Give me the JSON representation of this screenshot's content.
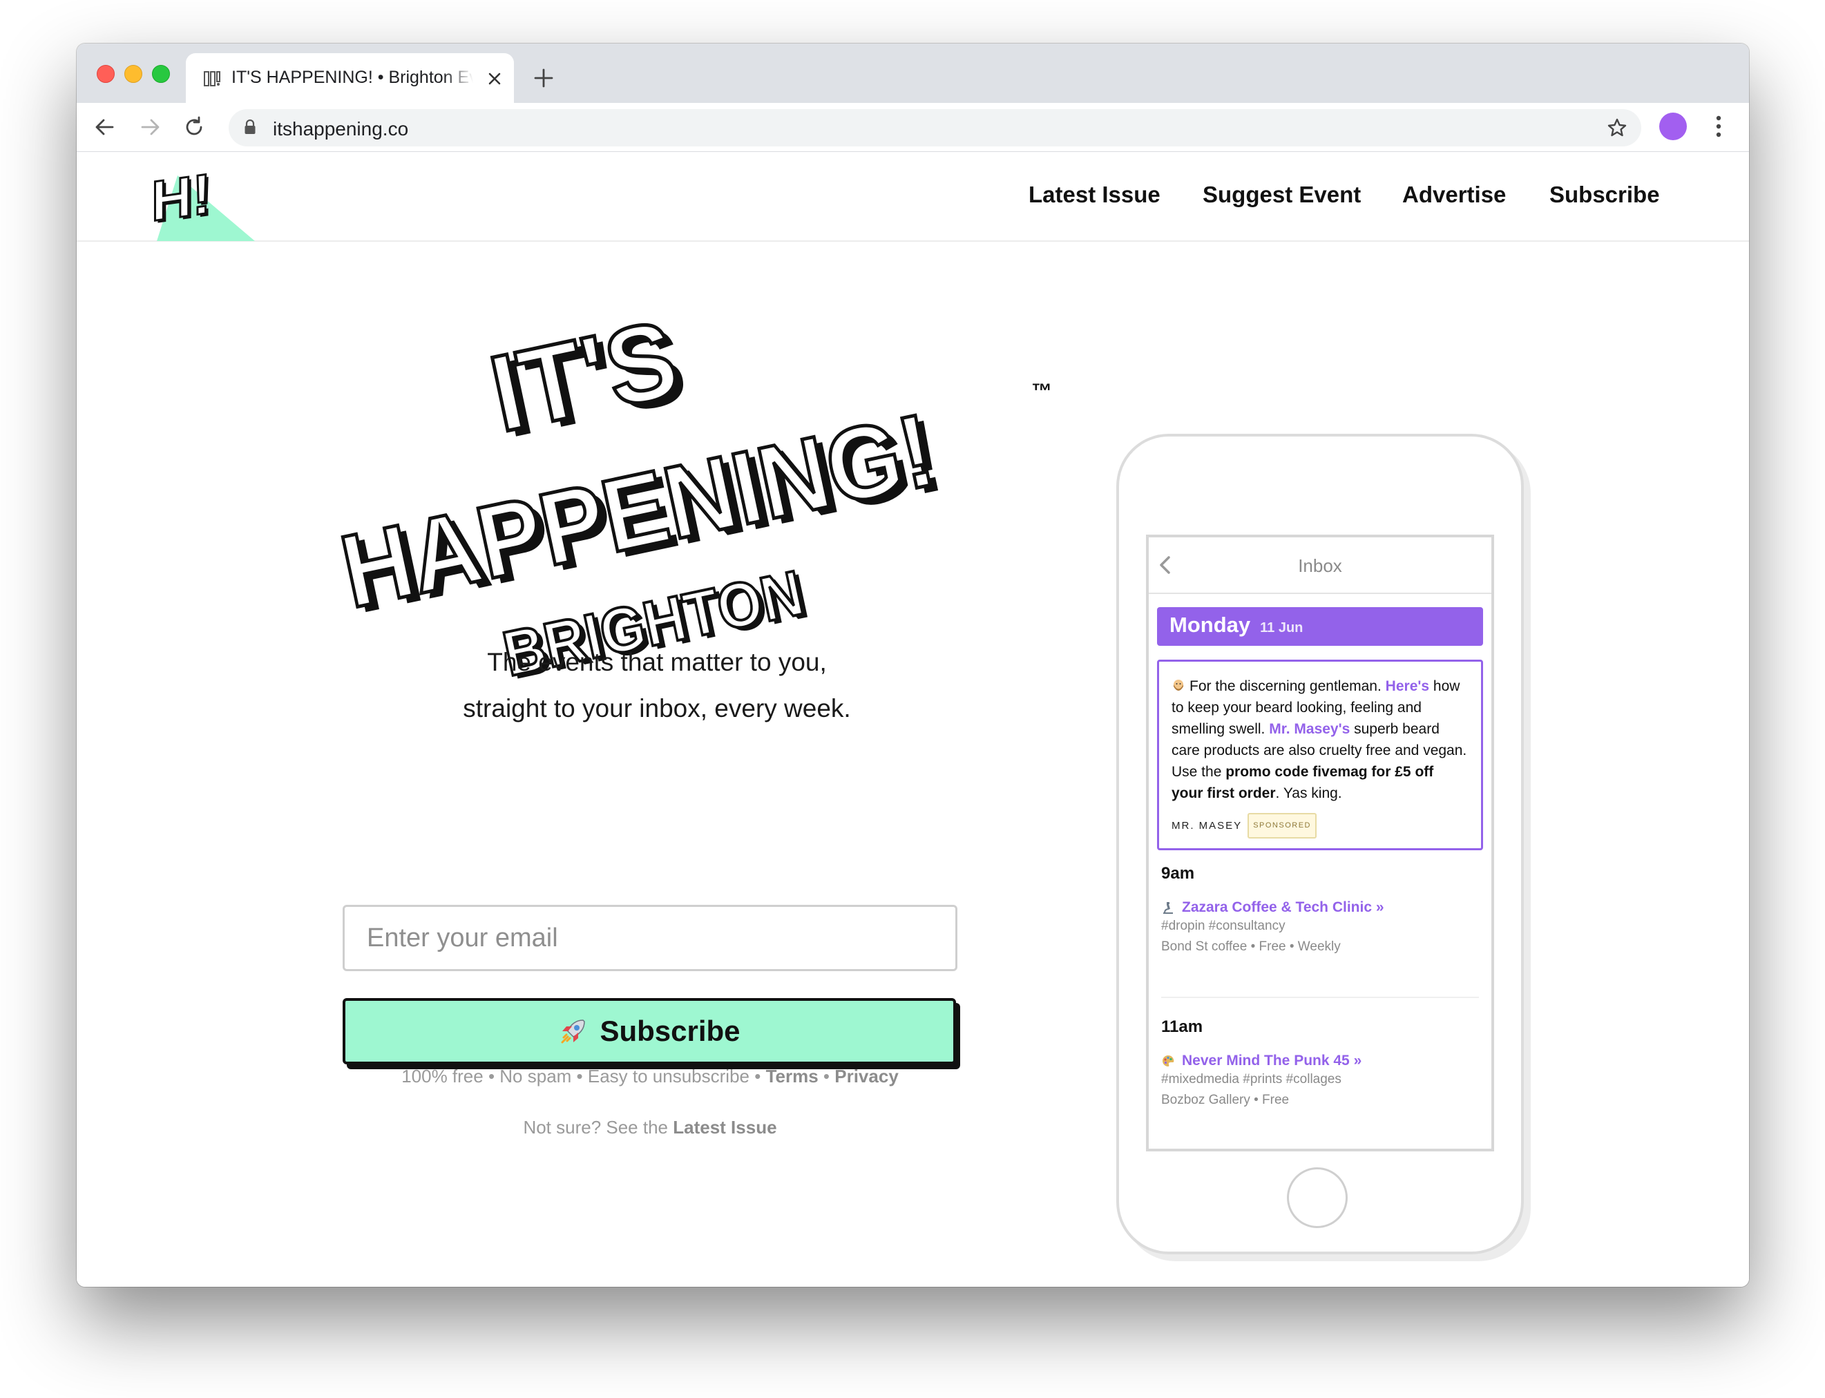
{
  "browser": {
    "tab_title": "IT'S HAPPENING! • Brighton Events",
    "url": "itshappening.co",
    "accent_avatar": "#a25ff0"
  },
  "site": {
    "nav": [
      {
        "label": "Latest Issue"
      },
      {
        "label": "Suggest Event"
      },
      {
        "label": "Advertise"
      },
      {
        "label": "Subscribe"
      }
    ],
    "hero": {
      "line1": "IT'S",
      "line2": "HAPPENING!",
      "tm": "™",
      "city": "BRIGHTON"
    },
    "tagline_1": "The events that matter to you,",
    "tagline_2": "straight to your inbox, every week.",
    "email_placeholder": "Enter your email",
    "subscribe_label": "Subscribe",
    "fineprint": {
      "text": "100% free • No spam • Easy to unsubscribe •",
      "terms": "Terms",
      "sep": "•",
      "privacy": "Privacy"
    },
    "notsure": {
      "text": "Not sure? See the",
      "link": "Latest Issue"
    },
    "colors": {
      "mint": "#9ef7d1",
      "purple": "#9362ea"
    }
  },
  "phone": {
    "inbox_title": "Inbox",
    "day": "Monday",
    "date": "11 Jun",
    "sponsor": {
      "p1": "For the discerning gentleman.",
      "link1": "Here's",
      "p2": "how to keep your beard looking, feeling and smelling swell.",
      "link2": "Mr. Masey's",
      "p3": "superb beard care products are also cruelty free and vegan. Use the",
      "bold": "promo code fivemag for £5 off your first order",
      "p4": ". Yas king.",
      "brand": "MR. MASEY",
      "badge": "SPONSORED"
    },
    "events": [
      {
        "time": "9am",
        "title": "Zazara Coffee & Tech Clinic »",
        "tags": "#dropin #consultancy",
        "meta": "Bond St coffee • Free • Weekly"
      },
      {
        "time": "11am",
        "title": "Never Mind The Punk 45 »",
        "tags": "#mixedmedia #prints #collages",
        "meta": "Bozboz Gallery • Free"
      }
    ]
  }
}
